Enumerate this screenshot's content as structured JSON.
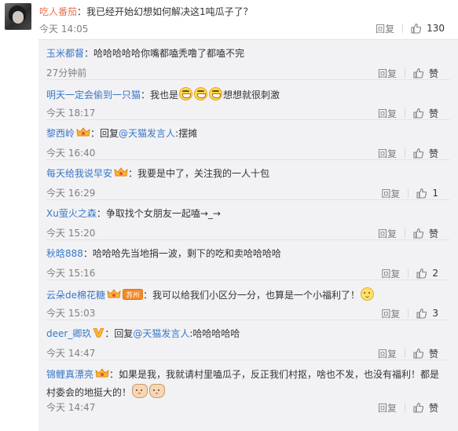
{
  "top_comment": {
    "author": "吃人番茄",
    "text": "：我已经开始幻想如何解决这1吨瓜子了？",
    "time": "今天 14:05",
    "reply_label": "回复",
    "like_count": "130"
  },
  "replies": [
    {
      "author": "玉米都督",
      "prefix": "",
      "mention": "",
      "text": "：哈哈哈哈哈你嘴都嗑秃噜了都嗑不完",
      "time": "27分钟前",
      "reply_label": "回复",
      "like_label": "赞"
    },
    {
      "author": "明天一定会偷到一只猫",
      "prefix": "",
      "mention": "",
      "text": "：我也是",
      "text_after": "想想就很刺激",
      "time": "今天 18:17",
      "reply_label": "回复",
      "like_label": "赞"
    },
    {
      "author": "黎西岭",
      "prefix": "：回复",
      "mention": "@天猫发言人",
      "text": ":摆摊",
      "time": "今天 16:40",
      "reply_label": "回复",
      "like_label": "赞"
    },
    {
      "author": "每天给我说早安",
      "prefix": "",
      "mention": "",
      "text": "：我要是中了，关注我的一人十包",
      "time": "今天 16:29",
      "reply_label": "回复",
      "like_label": "1"
    },
    {
      "author": "Xu萤火之森",
      "prefix": "",
      "mention": "",
      "text": "：争取找个女朋友一起嗑→_→",
      "time": "今天 15:20",
      "reply_label": "回复",
      "like_label": "赞"
    },
    {
      "author": "秋晗888",
      "prefix": "",
      "mention": "",
      "text": "：哈哈哈先当地捐一波，剩下的吃和卖哈哈哈哈",
      "time": "今天 15:16",
      "reply_label": "回复",
      "like_label": "2"
    },
    {
      "author": "云朵de棉花糖",
      "badge_city": "苏州",
      "prefix": "",
      "mention": "",
      "text": "：我可以给我们小区分一分，也算是一个小福利了！",
      "time": "今天 15:03",
      "reply_label": "回复",
      "like_label": "3"
    },
    {
      "author": "deer_卿玖",
      "prefix": "：回复",
      "mention": "@天猫发言人",
      "text": ":哈哈哈哈哈",
      "time": "今天 14:47",
      "reply_label": "回复",
      "like_label": "赞"
    },
    {
      "author": "锦鲤真漂亮",
      "prefix": "",
      "mention": "",
      "text": "：如果是我，我就请村里嗑瓜子，反正我们村抠，啥也不发，也没有福利！都是村委会的地挺大的！",
      "time": "今天 14:47",
      "reply_label": "回复",
      "like_label": "赞"
    }
  ],
  "icons": {
    "thumb": "thumbs-up-icon",
    "vip": "vip-crown-icon",
    "verified": "verified-v-icon"
  },
  "colors": {
    "author_top": "#eb7350",
    "author_reply": "#3877c6",
    "panel_bg": "#f2f2f5",
    "meta": "#808080"
  }
}
